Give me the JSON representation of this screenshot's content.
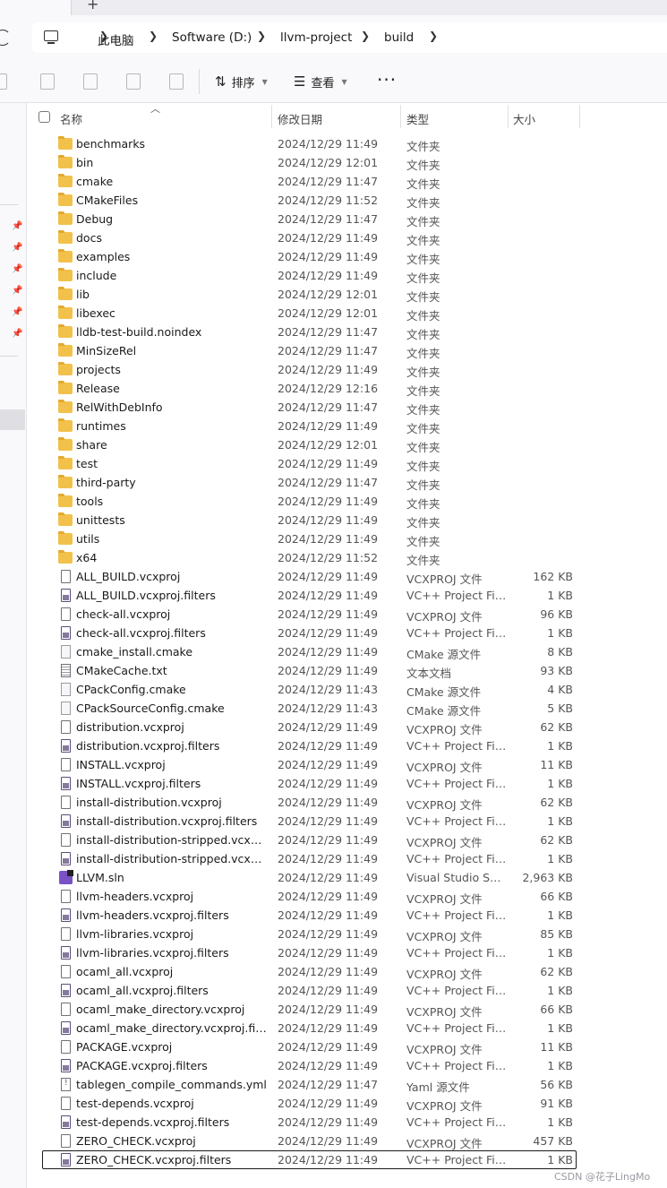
{
  "tabstrip": {
    "add_label": "+"
  },
  "breadcrumb": [
    "此电脑",
    "Software (D:)",
    "llvm-project",
    "build"
  ],
  "toolbar": {
    "sort_label": "排序",
    "view_label": "查看",
    "more_label": "···"
  },
  "columns": {
    "name": "名称",
    "date": "修改日期",
    "type": "类型",
    "size": "大小"
  },
  "files": [
    {
      "name": "benchmarks",
      "date": "2024/12/29 11:49",
      "type": "文件夹",
      "size": "",
      "icon": "folder-icon"
    },
    {
      "name": "bin",
      "date": "2024/12/29 12:01",
      "type": "文件夹",
      "size": "",
      "icon": "folder-icon"
    },
    {
      "name": "cmake",
      "date": "2024/12/29 11:47",
      "type": "文件夹",
      "size": "",
      "icon": "folder-icon"
    },
    {
      "name": "CMakeFiles",
      "date": "2024/12/29 11:52",
      "type": "文件夹",
      "size": "",
      "icon": "folder-icon"
    },
    {
      "name": "Debug",
      "date": "2024/12/29 11:47",
      "type": "文件夹",
      "size": "",
      "icon": "folder-icon"
    },
    {
      "name": "docs",
      "date": "2024/12/29 11:49",
      "type": "文件夹",
      "size": "",
      "icon": "folder-icon"
    },
    {
      "name": "examples",
      "date": "2024/12/29 11:49",
      "type": "文件夹",
      "size": "",
      "icon": "folder-icon"
    },
    {
      "name": "include",
      "date": "2024/12/29 11:49",
      "type": "文件夹",
      "size": "",
      "icon": "folder-icon"
    },
    {
      "name": "lib",
      "date": "2024/12/29 12:01",
      "type": "文件夹",
      "size": "",
      "icon": "folder-icon"
    },
    {
      "name": "libexec",
      "date": "2024/12/29 12:01",
      "type": "文件夹",
      "size": "",
      "icon": "folder-icon"
    },
    {
      "name": "lldb-test-build.noindex",
      "date": "2024/12/29 11:47",
      "type": "文件夹",
      "size": "",
      "icon": "folder-icon"
    },
    {
      "name": "MinSizeRel",
      "date": "2024/12/29 11:47",
      "type": "文件夹",
      "size": "",
      "icon": "folder-icon"
    },
    {
      "name": "projects",
      "date": "2024/12/29 11:49",
      "type": "文件夹",
      "size": "",
      "icon": "folder-icon"
    },
    {
      "name": "Release",
      "date": "2024/12/29 12:16",
      "type": "文件夹",
      "size": "",
      "icon": "folder-icon"
    },
    {
      "name": "RelWithDebInfo",
      "date": "2024/12/29 11:47",
      "type": "文件夹",
      "size": "",
      "icon": "folder-icon"
    },
    {
      "name": "runtimes",
      "date": "2024/12/29 11:49",
      "type": "文件夹",
      "size": "",
      "icon": "folder-icon"
    },
    {
      "name": "share",
      "date": "2024/12/29 12:01",
      "type": "文件夹",
      "size": "",
      "icon": "folder-icon"
    },
    {
      "name": "test",
      "date": "2024/12/29 11:49",
      "type": "文件夹",
      "size": "",
      "icon": "folder-icon"
    },
    {
      "name": "third-party",
      "date": "2024/12/29 11:47",
      "type": "文件夹",
      "size": "",
      "icon": "folder-icon"
    },
    {
      "name": "tools",
      "date": "2024/12/29 11:49",
      "type": "文件夹",
      "size": "",
      "icon": "folder-icon"
    },
    {
      "name": "unittests",
      "date": "2024/12/29 11:49",
      "type": "文件夹",
      "size": "",
      "icon": "folder-icon"
    },
    {
      "name": "utils",
      "date": "2024/12/29 11:49",
      "type": "文件夹",
      "size": "",
      "icon": "folder-icon"
    },
    {
      "name": "x64",
      "date": "2024/12/29 11:52",
      "type": "文件夹",
      "size": "",
      "icon": "folder-icon"
    },
    {
      "name": "ALL_BUILD.vcxproj",
      "date": "2024/12/29 11:49",
      "type": "VCXPROJ 文件",
      "size": "162 KB",
      "icon": "file-icon"
    },
    {
      "name": "ALL_BUILD.vcxproj.filters",
      "date": "2024/12/29 11:49",
      "type": "VC++ Project Fil...",
      "size": "1 KB",
      "icon": "filter-file-icon"
    },
    {
      "name": "check-all.vcxproj",
      "date": "2024/12/29 11:49",
      "type": "VCXPROJ 文件",
      "size": "96 KB",
      "icon": "file-icon"
    },
    {
      "name": "check-all.vcxproj.filters",
      "date": "2024/12/29 11:49",
      "type": "VC++ Project Fil...",
      "size": "1 KB",
      "icon": "filter-file-icon"
    },
    {
      "name": "cmake_install.cmake",
      "date": "2024/12/29 11:49",
      "type": "CMake 源文件",
      "size": "8 KB",
      "icon": "cmake-file-icon"
    },
    {
      "name": "CMakeCache.txt",
      "date": "2024/12/29 11:49",
      "type": "文本文档",
      "size": "93 KB",
      "icon": "text-file-icon"
    },
    {
      "name": "CPackConfig.cmake",
      "date": "2024/12/29 11:43",
      "type": "CMake 源文件",
      "size": "4 KB",
      "icon": "cmake-file-icon"
    },
    {
      "name": "CPackSourceConfig.cmake",
      "date": "2024/12/29 11:43",
      "type": "CMake 源文件",
      "size": "5 KB",
      "icon": "cmake-file-icon"
    },
    {
      "name": "distribution.vcxproj",
      "date": "2024/12/29 11:49",
      "type": "VCXPROJ 文件",
      "size": "62 KB",
      "icon": "file-icon"
    },
    {
      "name": "distribution.vcxproj.filters",
      "date": "2024/12/29 11:49",
      "type": "VC++ Project Fil...",
      "size": "1 KB",
      "icon": "filter-file-icon"
    },
    {
      "name": "INSTALL.vcxproj",
      "date": "2024/12/29 11:49",
      "type": "VCXPROJ 文件",
      "size": "11 KB",
      "icon": "file-icon"
    },
    {
      "name": "INSTALL.vcxproj.filters",
      "date": "2024/12/29 11:49",
      "type": "VC++ Project Fil...",
      "size": "1 KB",
      "icon": "filter-file-icon"
    },
    {
      "name": "install-distribution.vcxproj",
      "date": "2024/12/29 11:49",
      "type": "VCXPROJ 文件",
      "size": "62 KB",
      "icon": "file-icon"
    },
    {
      "name": "install-distribution.vcxproj.filters",
      "date": "2024/12/29 11:49",
      "type": "VC++ Project Fil...",
      "size": "1 KB",
      "icon": "filter-file-icon"
    },
    {
      "name": "install-distribution-stripped.vcxproj",
      "date": "2024/12/29 11:49",
      "type": "VCXPROJ 文件",
      "size": "62 KB",
      "icon": "file-icon"
    },
    {
      "name": "install-distribution-stripped.vcxpro...",
      "date": "2024/12/29 11:49",
      "type": "VC++ Project Fil...",
      "size": "1 KB",
      "icon": "filter-file-icon"
    },
    {
      "name": "LLVM.sln",
      "date": "2024/12/29 11:49",
      "type": "Visual Studio Sol...",
      "size": "2,963 KB",
      "icon": "solution-file-icon"
    },
    {
      "name": "llvm-headers.vcxproj",
      "date": "2024/12/29 11:49",
      "type": "VCXPROJ 文件",
      "size": "66 KB",
      "icon": "file-icon"
    },
    {
      "name": "llvm-headers.vcxproj.filters",
      "date": "2024/12/29 11:49",
      "type": "VC++ Project Fil...",
      "size": "1 KB",
      "icon": "filter-file-icon"
    },
    {
      "name": "llvm-libraries.vcxproj",
      "date": "2024/12/29 11:49",
      "type": "VCXPROJ 文件",
      "size": "85 KB",
      "icon": "file-icon"
    },
    {
      "name": "llvm-libraries.vcxproj.filters",
      "date": "2024/12/29 11:49",
      "type": "VC++ Project Fil...",
      "size": "1 KB",
      "icon": "filter-file-icon"
    },
    {
      "name": "ocaml_all.vcxproj",
      "date": "2024/12/29 11:49",
      "type": "VCXPROJ 文件",
      "size": "62 KB",
      "icon": "file-icon"
    },
    {
      "name": "ocaml_all.vcxproj.filters",
      "date": "2024/12/29 11:49",
      "type": "VC++ Project Fil...",
      "size": "1 KB",
      "icon": "filter-file-icon"
    },
    {
      "name": "ocaml_make_directory.vcxproj",
      "date": "2024/12/29 11:49",
      "type": "VCXPROJ 文件",
      "size": "66 KB",
      "icon": "file-icon"
    },
    {
      "name": "ocaml_make_directory.vcxproj.filters",
      "date": "2024/12/29 11:49",
      "type": "VC++ Project Fil...",
      "size": "1 KB",
      "icon": "filter-file-icon"
    },
    {
      "name": "PACKAGE.vcxproj",
      "date": "2024/12/29 11:49",
      "type": "VCXPROJ 文件",
      "size": "11 KB",
      "icon": "file-icon"
    },
    {
      "name": "PACKAGE.vcxproj.filters",
      "date": "2024/12/29 11:49",
      "type": "VC++ Project Fil...",
      "size": "1 KB",
      "icon": "filter-file-icon"
    },
    {
      "name": "tablegen_compile_commands.yml",
      "date": "2024/12/29 11:47",
      "type": "Yaml 源文件",
      "size": "56 KB",
      "icon": "yaml-file-icon"
    },
    {
      "name": "test-depends.vcxproj",
      "date": "2024/12/29 11:49",
      "type": "VCXPROJ 文件",
      "size": "91 KB",
      "icon": "file-icon"
    },
    {
      "name": "test-depends.vcxproj.filters",
      "date": "2024/12/29 11:49",
      "type": "VC++ Project Fil...",
      "size": "1 KB",
      "icon": "filter-file-icon"
    },
    {
      "name": "ZERO_CHECK.vcxproj",
      "date": "2024/12/29 11:49",
      "type": "VCXPROJ 文件",
      "size": "457 KB",
      "icon": "file-icon"
    },
    {
      "name": "ZERO_CHECK.vcxproj.filters",
      "date": "2024/12/29 11:49",
      "type": "VC++ Project Fil...",
      "size": "1 KB",
      "icon": "filter-file-icon",
      "focused": true
    }
  ],
  "watermark": "CSDN @花子LingMo"
}
